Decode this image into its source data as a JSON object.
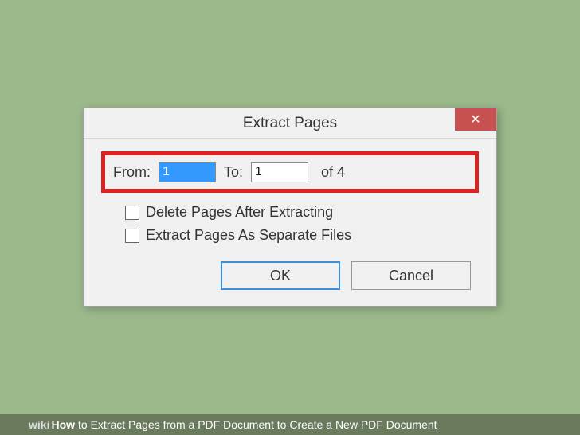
{
  "dialog": {
    "title": "Extract Pages",
    "page_range": {
      "from_label": "From:",
      "from_value": "1",
      "to_label": "To:",
      "to_value": "1",
      "of_text": "of 4"
    },
    "checkboxes": {
      "delete_after": "Delete Pages After Extracting",
      "separate_files": "Extract Pages As Separate Files"
    },
    "buttons": {
      "ok": "OK",
      "cancel": "Cancel"
    },
    "close_glyph": "✕"
  },
  "caption": {
    "wiki": "wiki",
    "how": "How",
    "text": " to Extract Pages from a PDF Document to Create a New PDF Document"
  }
}
